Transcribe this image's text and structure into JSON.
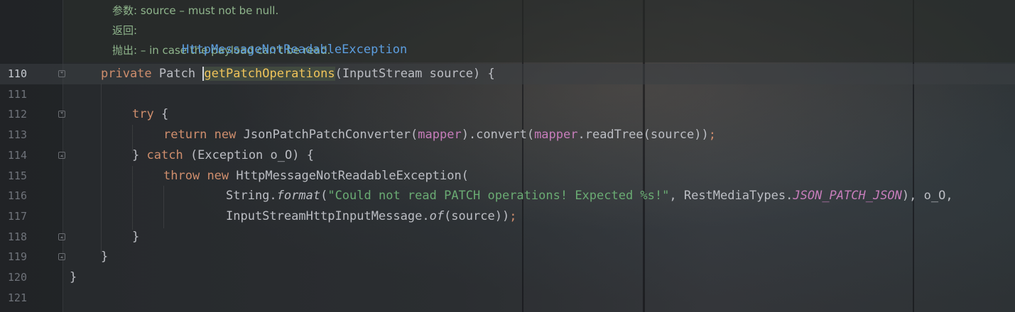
{
  "doc": {
    "params_label": "参数:",
    "params_text": "source – must not be null.",
    "returns_label": "返回:",
    "throws_label": "抛出:",
    "throws_class": "HttpMessageNotReadableException",
    "throws_text": "– in case the payload can't be read."
  },
  "lines": [
    {
      "num": "110"
    },
    {
      "num": "111"
    },
    {
      "num": "112"
    },
    {
      "num": "113"
    },
    {
      "num": "114"
    },
    {
      "num": "115"
    },
    {
      "num": "116"
    },
    {
      "num": "117"
    },
    {
      "num": "118"
    },
    {
      "num": "119"
    },
    {
      "num": "120"
    },
    {
      "num": "121"
    }
  ],
  "code": {
    "l110": {
      "kw": "private",
      "type": "Patch",
      "method": "getPatchOperations",
      "rest": "(InputStream source) {"
    },
    "l112": {
      "kw": "try",
      "rest": "{"
    },
    "l113": {
      "kw1": "return",
      "kw2": "new",
      "cls": "JsonPatchPatchConverter(",
      "f1": "mapper",
      "mid": ").convert(",
      "f2": "mapper",
      "tail": ".readTree(source))",
      "semi": ";"
    },
    "l114": {
      "pre": "}",
      "kw": "catch",
      "rest": "(Exception o_O) {"
    },
    "l115": {
      "kw1": "throw",
      "kw2": "new",
      "rest": "HttpMessageNotReadableException("
    },
    "l116": {
      "pre": "String.",
      "fn": "format",
      "open": "(",
      "str": "\"Could not read PATCH operations! Expected %s!\"",
      "mid": ", RestMediaTypes.",
      "const": "JSON_PATCH_JSON",
      "tail": "), o_O,"
    },
    "l117": {
      "pre": "InputStreamHttpInputMessage.",
      "fn": "of",
      "tail": "(source))",
      "semi": ";"
    },
    "l118": {
      "text": "}"
    },
    "l119": {
      "text": "}"
    },
    "l120": {
      "text": "}"
    }
  }
}
